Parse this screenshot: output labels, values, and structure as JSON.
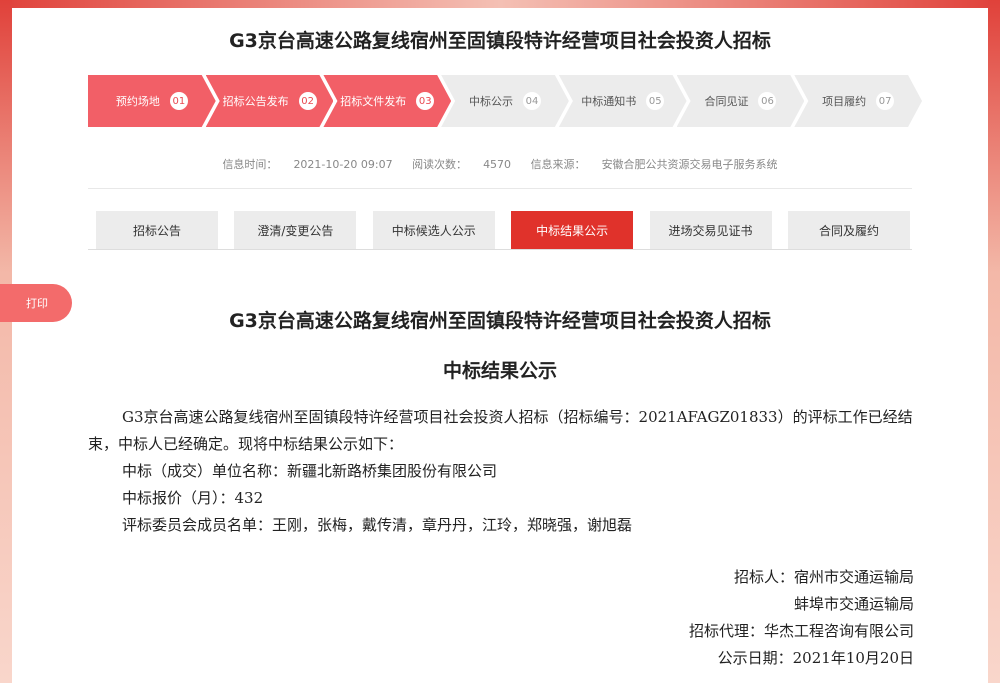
{
  "page_title": "G3京台高速公路复线宿州至固镇段特许经营项目社会投资人招标",
  "steps": [
    {
      "label": "预约场地",
      "num": "01",
      "active": true
    },
    {
      "label": "招标公告发布",
      "num": "02",
      "active": true
    },
    {
      "label": "招标文件发布",
      "num": "03",
      "active": true
    },
    {
      "label": "中标公示",
      "num": "04",
      "active": false
    },
    {
      "label": "中标通知书",
      "num": "05",
      "active": false
    },
    {
      "label": "合同见证",
      "num": "06",
      "active": false
    },
    {
      "label": "项目履约",
      "num": "07",
      "active": false
    }
  ],
  "meta": {
    "time_label": "信息时间：",
    "time_value": "2021-10-20 09:07",
    "views_label": "阅读次数：",
    "views_value": "4570",
    "source_label": "信息来源：",
    "source_value": "安徽合肥公共资源交易电子服务系统"
  },
  "tabs": [
    {
      "label": "招标公告",
      "active": false
    },
    {
      "label": "澄清/变更公告",
      "active": false
    },
    {
      "label": "中标候选人公示",
      "active": false
    },
    {
      "label": "中标结果公示",
      "active": true
    },
    {
      "label": "进场交易见证书",
      "active": false
    },
    {
      "label": "合同及履约",
      "active": false
    }
  ],
  "print_label": "打印",
  "document": {
    "title": "G3京台高速公路复线宿州至固镇段特许经营项目社会投资人招标",
    "subtitle": "中标结果公示",
    "intro": "G3京台高速公路复线宿州至固镇段特许经营项目社会投资人招标（招标编号：2021AFAGZ01833）的评标工作已经结束，中标人已经确定。现将中标结果公示如下：",
    "winner": "中标（成交）单位名称：新疆北新路桥集团股份有限公司",
    "price": "中标报价（月）：432",
    "committee": "评标委员会成员名单：王刚，张梅，戴传清，章丹丹，江玲，郑晓强，谢旭磊"
  },
  "signature": {
    "tenderer": "招标人：宿州市交通运输局",
    "tenderer2": "蚌埠市交通运输局",
    "agent": "招标代理：华杰工程咨询有限公司",
    "date": "公示日期：2021年10月20日"
  },
  "colors": {
    "accent": "#e0322b",
    "step_active": "#f25f67",
    "print_button": "#f36b6b"
  }
}
